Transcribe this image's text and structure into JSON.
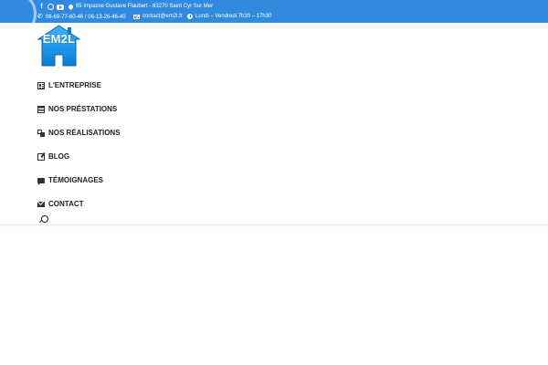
{
  "topbar": {
    "background": "#2f8ae0",
    "social": [
      "facebook-icon",
      "whatsapp-icon",
      "youtube-icon"
    ],
    "address": "65 Impasse Gustave Flaubert - 83270 Saint Cyr Sur Mer",
    "phones": "06-69-77-60-46 / 06-13-26-46-40",
    "email": "contact@em2l.fr",
    "hours": "Lundi – Vendredi 7h30 – 17h30"
  },
  "logo": {
    "text": "EM2L",
    "color": "#1e9bef"
  },
  "nav": {
    "items": [
      {
        "label": "L'ENTREPRISE",
        "icon": "building-icon"
      },
      {
        "label": "NOS PRÉSTATIONS",
        "icon": "list-icon"
      },
      {
        "label": "NOS RÉALISATIONS",
        "icon": "images-icon"
      },
      {
        "label": "BLOG",
        "icon": "edit-icon"
      },
      {
        "label": "TÉMOIGNAGES",
        "icon": "comment-icon"
      },
      {
        "label": "CONTACT",
        "icon": "envelope-icon"
      }
    ]
  }
}
